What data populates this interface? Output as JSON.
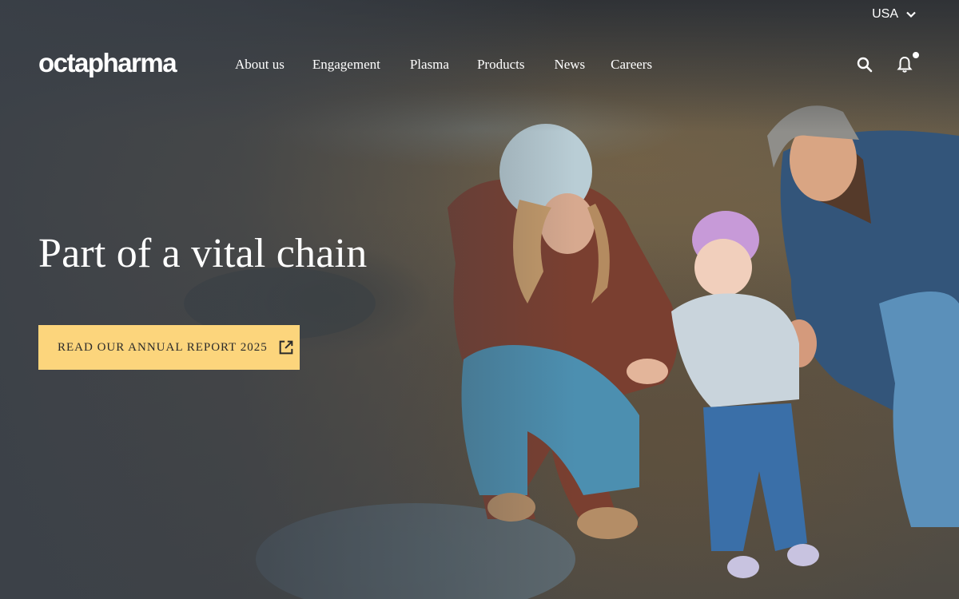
{
  "topbar": {
    "country": "USA",
    "chevron_icon": "chevron-down-icon"
  },
  "brand": {
    "logo_text": "octapharma"
  },
  "nav": {
    "items": [
      {
        "label": "About us"
      },
      {
        "label": "Engagement"
      },
      {
        "label": "Plasma"
      },
      {
        "label": "Products"
      },
      {
        "label": "News"
      },
      {
        "label": "Careers"
      }
    ]
  },
  "tools": {
    "search_icon": "search-icon",
    "notifications_icon": "bell-icon"
  },
  "hero": {
    "headline": "Part of a vital chain",
    "cta_label": "READ OUR ANNUAL REPORT 2025",
    "cta_icon": "external-link-icon",
    "image_subject": "family-of-three-outdoors-photo"
  },
  "colors": {
    "cta_background": "#fcd57c",
    "text": "#ffffff"
  }
}
